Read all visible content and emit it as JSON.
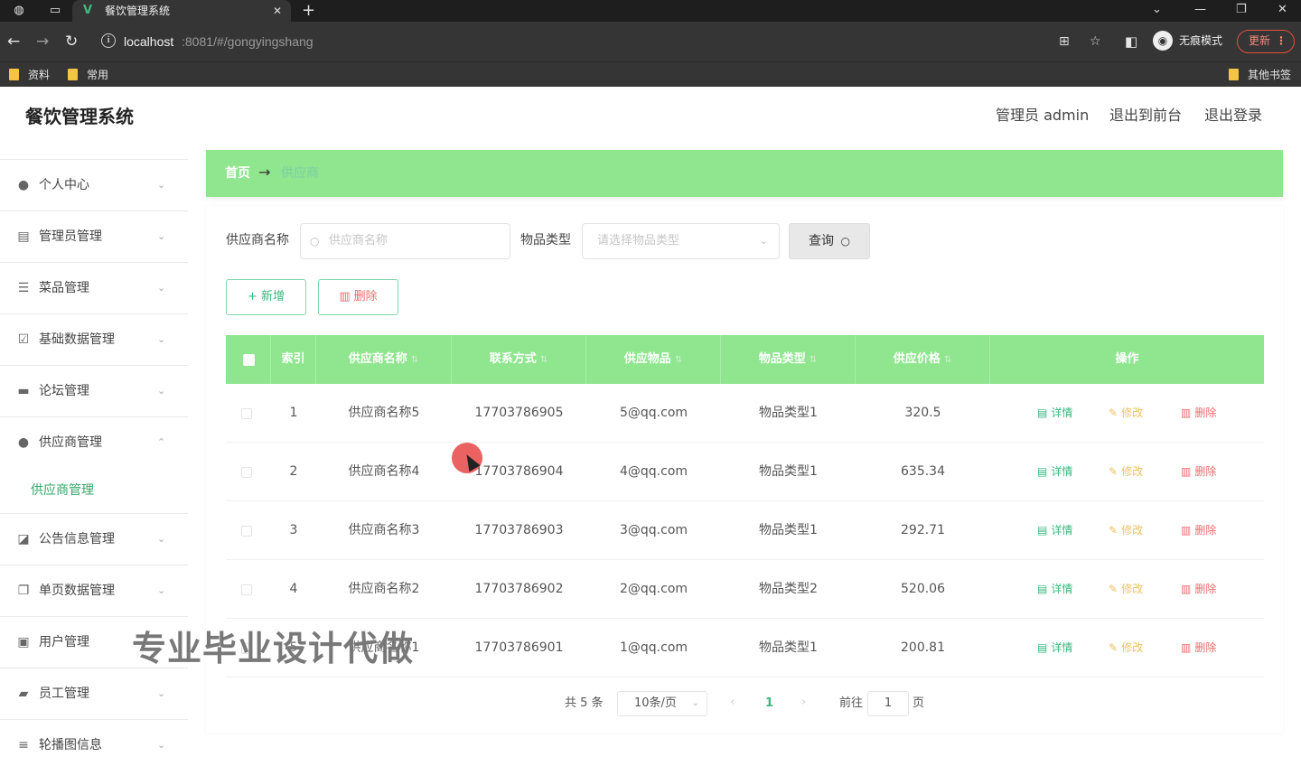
{
  "browser": {
    "tab_title": "餐饮管理系统",
    "url_host": "localhost",
    "url_path": ":8081/#/gongyingshang",
    "profile_label": "无痕模式",
    "update_label": "更新",
    "bookmarks": [
      "资料",
      "常用"
    ],
    "other_bookmarks": "其他书签"
  },
  "header": {
    "app_title": "餐饮管理系统",
    "admin_label": "管理员 admin",
    "front_label": "退出到前台",
    "logout_label": "退出登录"
  },
  "sidebar": {
    "items": [
      {
        "label": "个人中心",
        "icon": "user-icon",
        "expanded": false
      },
      {
        "label": "管理员管理",
        "icon": "clipboard-icon",
        "expanded": false
      },
      {
        "label": "菜品管理",
        "icon": "sliders-icon",
        "expanded": false
      },
      {
        "label": "基础数据管理",
        "icon": "checklist-icon",
        "expanded": false
      },
      {
        "label": "论坛管理",
        "icon": "briefcase-icon",
        "expanded": false
      },
      {
        "label": "供应商管理",
        "icon": "user-icon",
        "expanded": true
      },
      {
        "label": "公告信息管理",
        "icon": "chart-icon",
        "expanded": false
      },
      {
        "label": "单页数据管理",
        "icon": "copy-icon",
        "expanded": false
      },
      {
        "label": "用户管理",
        "icon": "calendar-x-icon",
        "expanded": false
      },
      {
        "label": "员工管理",
        "icon": "chat-icon",
        "expanded": false
      },
      {
        "label": "轮播图信息",
        "icon": "list-icon",
        "expanded": false
      }
    ],
    "subitem_label": "供应商管理"
  },
  "breadcrumb": {
    "home": "首页",
    "current": "供应商"
  },
  "search": {
    "name_label": "供应商名称",
    "name_placeholder": "供应商名称",
    "type_label": "物品类型",
    "type_placeholder": "请选择物品类型",
    "query_label": "查询"
  },
  "actions": {
    "add_label": "新增",
    "delete_label": "删除"
  },
  "table": {
    "headers": [
      "索引",
      "供应商名称",
      "联系方式",
      "供应物品",
      "物品类型",
      "供应价格",
      "操作"
    ],
    "rows": [
      {
        "index": "1",
        "name": "供应商名称5",
        "phone": "17703786905",
        "item": "5@qq.com",
        "type": "物品类型1",
        "price": "320.5"
      },
      {
        "index": "2",
        "name": "供应商名称4",
        "phone": "17703786904",
        "item": "4@qq.com",
        "type": "物品类型1",
        "price": "635.34"
      },
      {
        "index": "3",
        "name": "供应商名称3",
        "phone": "17703786903",
        "item": "3@qq.com",
        "type": "物品类型1",
        "price": "292.71"
      },
      {
        "index": "4",
        "name": "供应商名称2",
        "phone": "17703786902",
        "item": "2@qq.com",
        "type": "物品类型2",
        "price": "520.06"
      },
      {
        "index": "5",
        "name": "供应商名称1",
        "phone": "17703786901",
        "item": "1@qq.com",
        "type": "物品类型1",
        "price": "200.81"
      }
    ],
    "op_detail": "详情",
    "op_edit": "修改",
    "op_delete": "删除"
  },
  "pagination": {
    "total": "共 5 条",
    "page_size": "10条/页",
    "current_page": "1",
    "goto_label": "前往",
    "goto_value": "1",
    "unit": "页"
  },
  "watermark": "专业毕业设计代做",
  "colors": {
    "accent_green": "#8fe68f",
    "primary_text_green": "#3bb77e",
    "danger": "#ef6b6b",
    "warning": "#f0c15a"
  }
}
